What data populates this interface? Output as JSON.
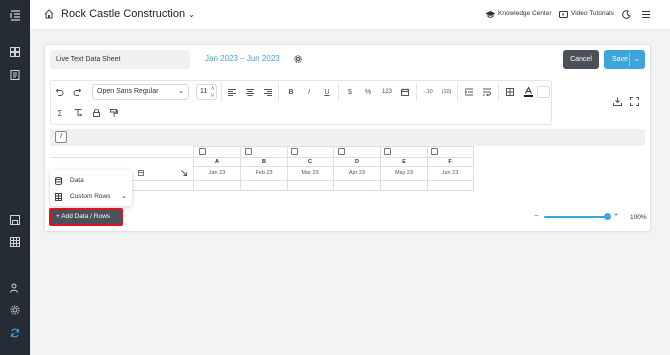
{
  "header": {
    "company": "Rock Castle Construction",
    "knowledge_center": "Knowledge Center",
    "video_tutorials": "Video Tutorials"
  },
  "editor": {
    "sheet_name": "Live Text Data Sheet",
    "date_range": "Jan 2023 – Jun 2023",
    "cancel_label": "Cancel",
    "save_label": "Save"
  },
  "toolbar": {
    "font": "Open Sans Regular",
    "font_size": "11",
    "decimal_decrease": "-.10",
    "decimal_paren": "(10)",
    "number_format": "123",
    "currency": "$",
    "percent": "%",
    "bold": "B",
    "italic": "I",
    "underline": "U",
    "sigma": "Σ"
  },
  "grid": {
    "columns": [
      {
        "letter": "A",
        "date": "Jan 23"
      },
      {
        "letter": "B",
        "date": "Feb 23"
      },
      {
        "letter": "C",
        "date": "Mar 23"
      },
      {
        "letter": "D",
        "date": "Apr 23"
      },
      {
        "letter": "E",
        "date": "May 23"
      },
      {
        "letter": "F",
        "date": "Jun 23"
      }
    ]
  },
  "popup": {
    "data_label": "Data",
    "custom_rows_label": "Custom Rows"
  },
  "add_button": "+  Add Data / Rows",
  "zoom": {
    "value": "100%",
    "minus": "−",
    "plus": "+"
  },
  "colors": {
    "sidebar": "#252c35",
    "accent": "#3da4dc",
    "highlight": "#e0141b"
  }
}
